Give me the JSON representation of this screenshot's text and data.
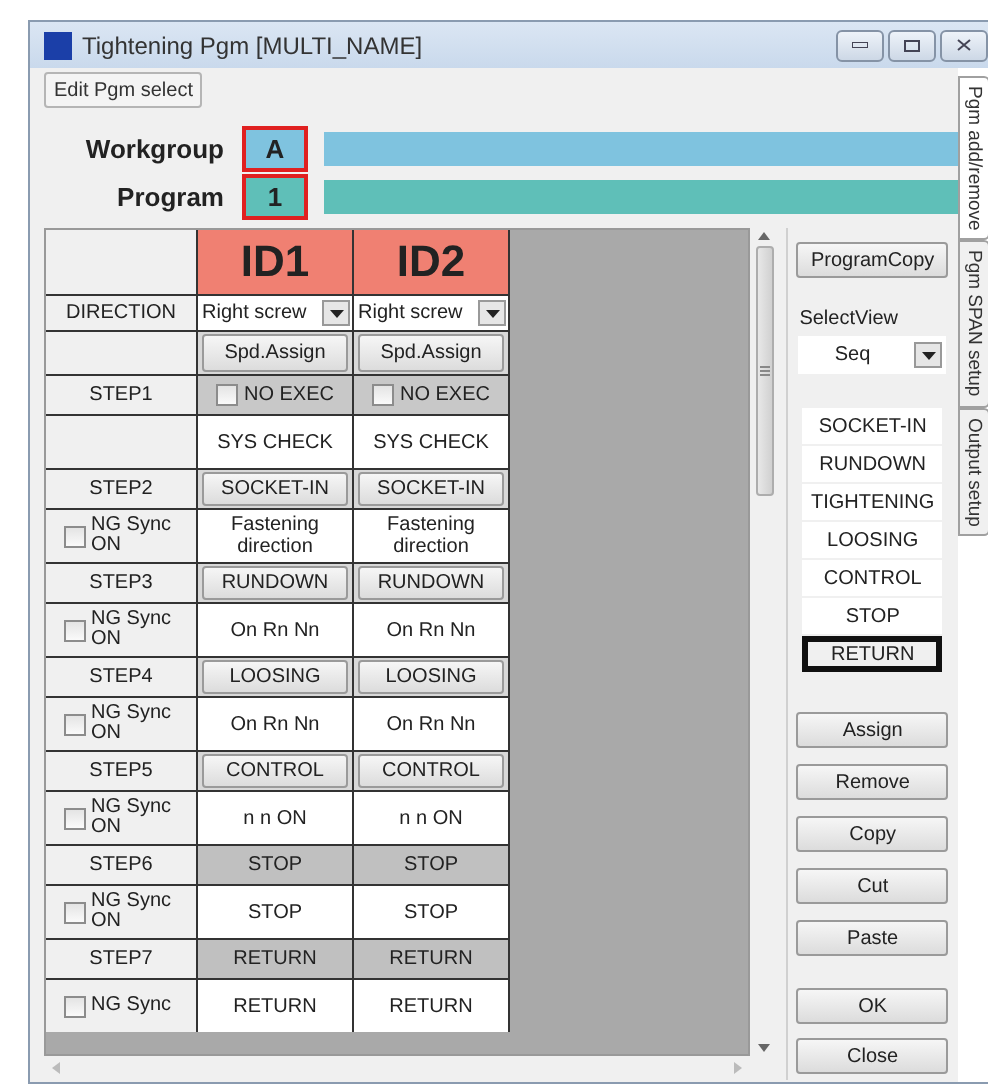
{
  "window": {
    "title": "Tightening Pgm [MULTI_NAME]"
  },
  "side_tabs": [
    {
      "label": "Pgm add/remove",
      "selected": true
    },
    {
      "label": "Pgm SPAN setup",
      "selected": false
    },
    {
      "label": "Output setup",
      "selected": false
    }
  ],
  "edit_button": "Edit Pgm select",
  "workgroup": {
    "label": "Workgroup",
    "value": "A"
  },
  "program": {
    "label": "Program",
    "value": "1"
  },
  "table": {
    "direction_label": "DIRECTION",
    "columns": [
      {
        "label": "ID1",
        "direction": "Right screw",
        "assign_button": "Spd.Assign"
      },
      {
        "label": "ID2",
        "direction": "Right screw",
        "assign_button": "Spd.Assign"
      }
    ],
    "steps": [
      {
        "label": "STEP1",
        "cells": [
          {
            "kind": "checkbox",
            "label": "NO EXEC",
            "checked": false,
            "value": "SYS CHECK"
          },
          {
            "kind": "checkbox",
            "label": "NO EXEC",
            "checked": false,
            "value": "SYS CHECK"
          }
        ]
      },
      {
        "label": "STEP2",
        "ng_sync": {
          "label": "NG Sync ON",
          "checked": false
        },
        "cells": [
          {
            "kind": "button",
            "label": "SOCKET-IN",
            "value": "Fastening direction"
          },
          {
            "kind": "button",
            "label": "SOCKET-IN",
            "value": "Fastening direction"
          }
        ]
      },
      {
        "label": "STEP3",
        "ng_sync": {
          "label": "NG Sync ON",
          "checked": false
        },
        "cells": [
          {
            "kind": "button",
            "label": "RUNDOWN",
            "value": "On Rn Nn"
          },
          {
            "kind": "button",
            "label": "RUNDOWN",
            "value": "On Rn Nn"
          }
        ]
      },
      {
        "label": "STEP4",
        "ng_sync": {
          "label": "NG Sync ON",
          "checked": false
        },
        "cells": [
          {
            "kind": "button",
            "label": "LOOSING",
            "value": "On Rn Nn"
          },
          {
            "kind": "button",
            "label": "LOOSING",
            "value": "On Rn Nn"
          }
        ]
      },
      {
        "label": "STEP5",
        "ng_sync": {
          "label": "NG Sync ON",
          "checked": false
        },
        "cells": [
          {
            "kind": "button",
            "label": "CONTROL",
            "value": "n n ON"
          },
          {
            "kind": "button",
            "label": "CONTROL",
            "value": "n n ON"
          }
        ]
      },
      {
        "label": "STEP6",
        "ng_sync": {
          "label": "NG Sync ON",
          "checked": false
        },
        "cells": [
          {
            "kind": "plain",
            "label": "STOP",
            "value": "STOP"
          },
          {
            "kind": "plain",
            "label": "STOP",
            "value": "STOP"
          }
        ]
      },
      {
        "label": "STEP7",
        "ng_sync": {
          "label": "NG Sync",
          "checked": false
        },
        "cells": [
          {
            "kind": "plain",
            "label": "RETURN",
            "value": "RETURN"
          },
          {
            "kind": "plain",
            "label": "RETURN",
            "value": "RETURN"
          }
        ]
      }
    ]
  },
  "right_panel": {
    "copy_button": "ProgramCopy",
    "view_label": "SelectView",
    "view_value": "Seq",
    "items": [
      {
        "label": "SOCKET-IN",
        "selected": false
      },
      {
        "label": "RUNDOWN",
        "selected": false
      },
      {
        "label": "TIGHTENING",
        "selected": false
      },
      {
        "label": "LOOSING",
        "selected": false
      },
      {
        "label": "CONTROL",
        "selected": false
      },
      {
        "label": "STOP",
        "selected": false
      },
      {
        "label": "RETURN",
        "selected": true
      }
    ],
    "buttons": [
      "Assign",
      "Remove",
      "Copy",
      "Cut",
      "Paste"
    ],
    "dialog_buttons": [
      "OK",
      "Close"
    ]
  }
}
